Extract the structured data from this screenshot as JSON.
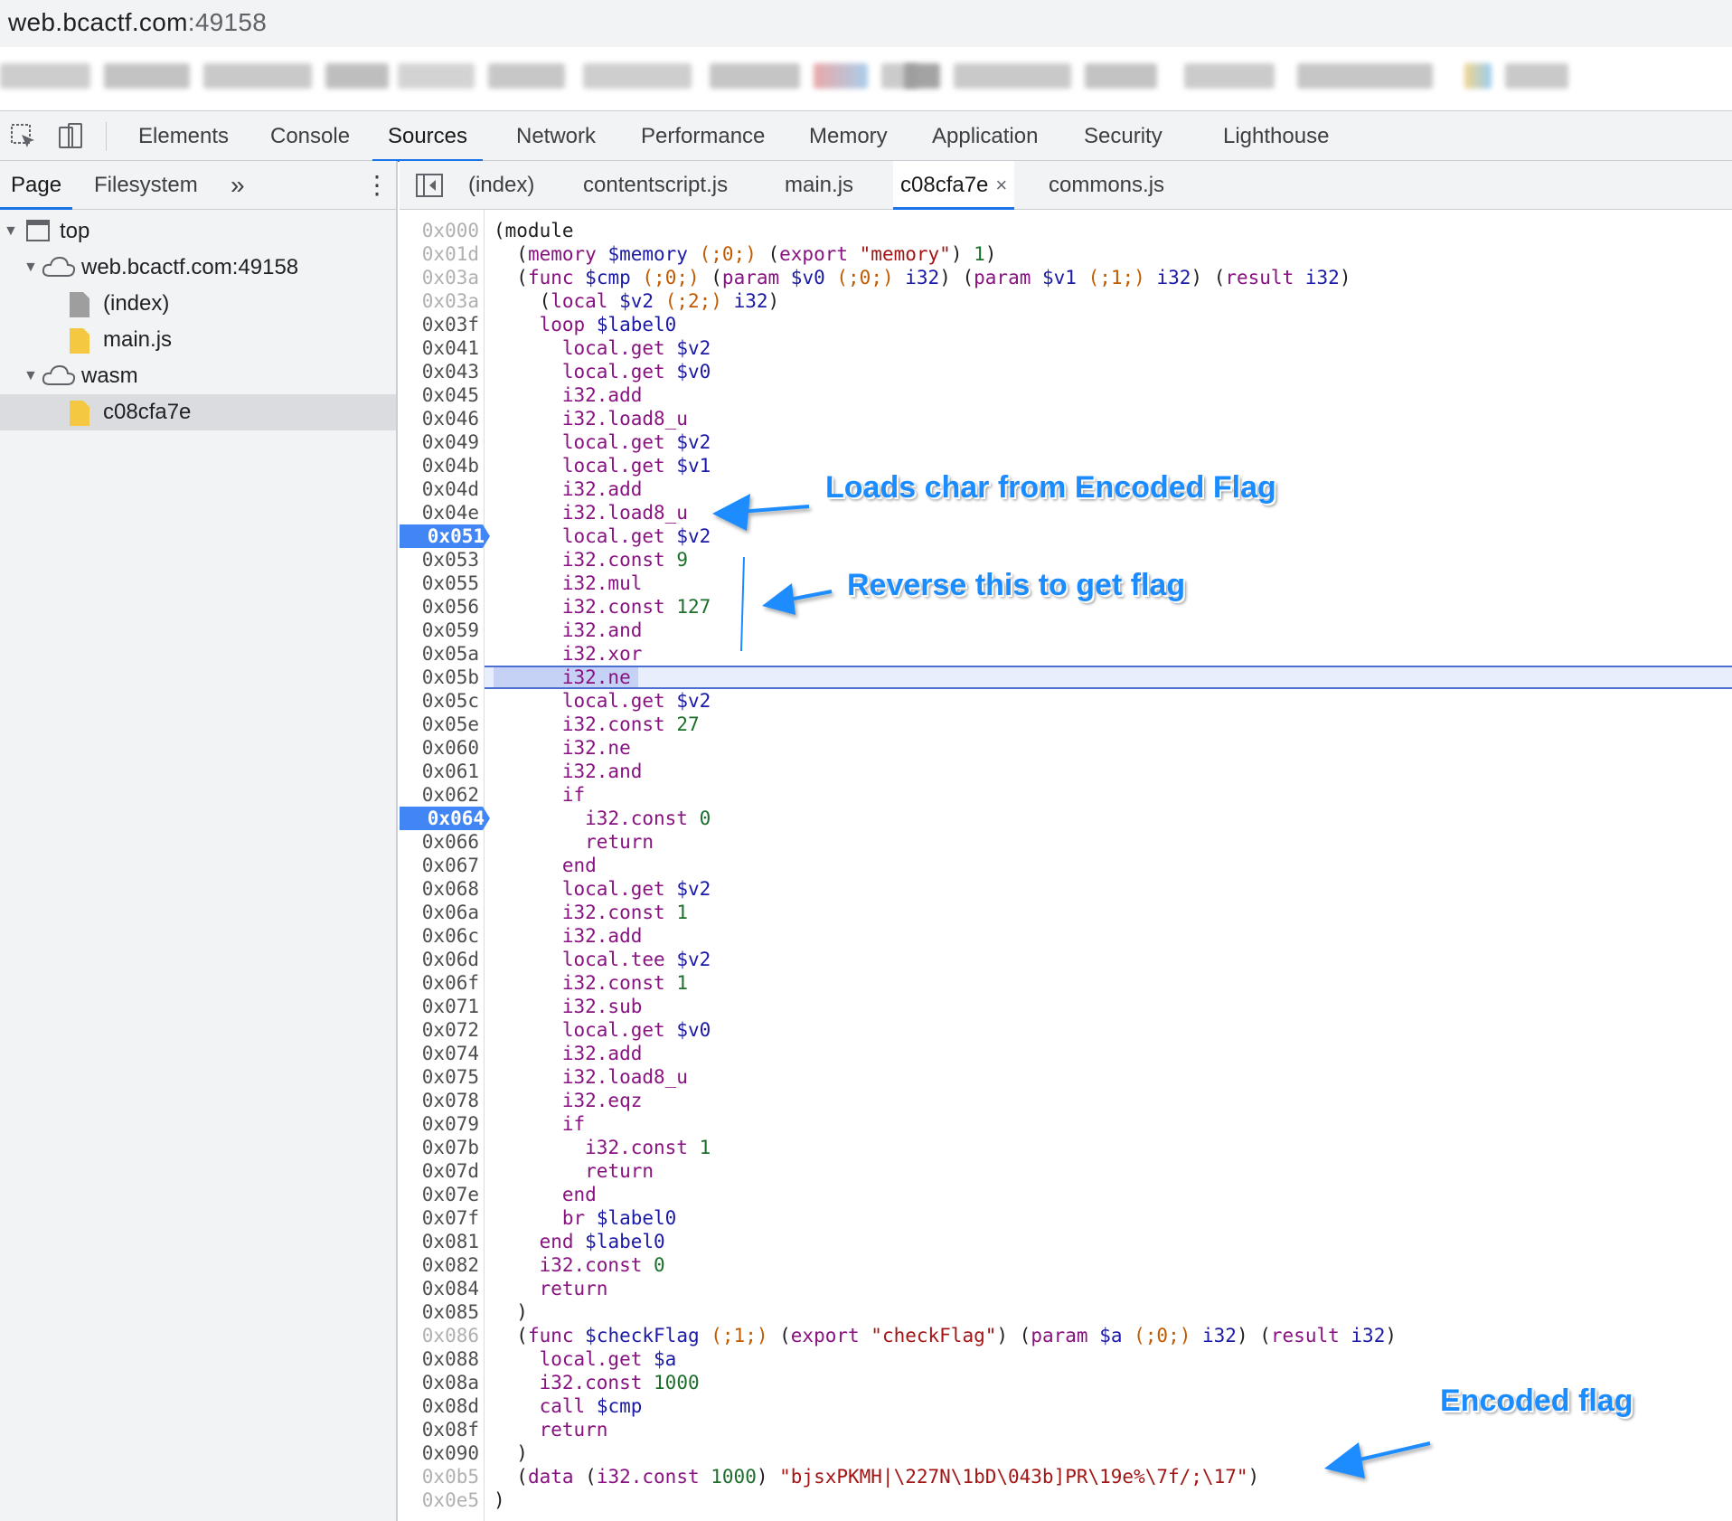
{
  "browser": {
    "url_host": "web.bcactf.com",
    "url_port": ":49158"
  },
  "devtools": {
    "tabs": [
      "Elements",
      "Console",
      "Sources",
      "Network",
      "Performance",
      "Memory",
      "Application",
      "Security",
      "Lighthouse"
    ],
    "active_tab": "Sources"
  },
  "navigator": {
    "tabs": [
      "Page",
      "Filesystem"
    ],
    "more": "»",
    "menu": "⋮",
    "tree": [
      {
        "label": "top"
      },
      {
        "label": "web.bcactf.com:49158"
      },
      {
        "label": "(index)"
      },
      {
        "label": "main.js"
      },
      {
        "label": "wasm"
      },
      {
        "label": "c08cfa7e"
      }
    ]
  },
  "editor": {
    "tabs": [
      "(index)",
      "contentscript.js",
      "main.js",
      "c08cfa7e",
      "commons.js"
    ],
    "active_tab": "c08cfa7e",
    "close": "×"
  },
  "code": {
    "line_numbers": [
      "0x000",
      "0x01d",
      "0x03a",
      "0x03a",
      "0x03f",
      "0x041",
      "0x043",
      "0x045",
      "0x046",
      "0x049",
      "0x04b",
      "0x04d",
      "0x04e",
      "0x051",
      "0x053",
      "0x055",
      "0x056",
      "0x059",
      "0x05a",
      "0x05b",
      "0x05c",
      "0x05e",
      "0x060",
      "0x061",
      "0x062",
      "0x064",
      "0x066",
      "0x067",
      "0x068",
      "0x06a",
      "0x06c",
      "0x06d",
      "0x06f",
      "0x071",
      "0x072",
      "0x074",
      "0x075",
      "0x078",
      "0x079",
      "0x07b",
      "0x07d",
      "0x07e",
      "0x07f",
      "0x081",
      "0x082",
      "0x084",
      "0x085",
      "0x086",
      "0x088",
      "0x08a",
      "0x08d",
      "0x08f",
      "0x090",
      "0x0b5",
      "0x0e5"
    ],
    "breakpoints": [
      "0x051",
      "0x064"
    ]
  },
  "annotations": {
    "load_char": "Loads char from Encoded Flag",
    "reverse": "Reverse this to get flag",
    "encoded": "Encoded flag"
  },
  "colors": {
    "accent": "#1a73e8",
    "annotation": "#1a8cff",
    "breakpoint": "#4285f4"
  }
}
